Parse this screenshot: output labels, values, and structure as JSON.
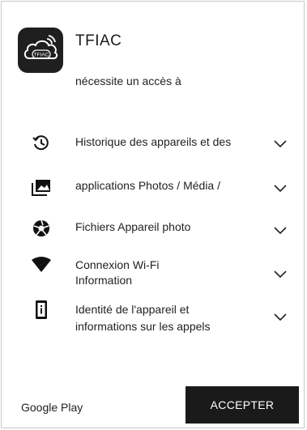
{
  "app": {
    "name": "TFIAC",
    "icon": "tfiac-cloud-logo-icon",
    "icon_text": "TFIAC"
  },
  "subtitle": "nécessite un accès à",
  "permissions": [
    {
      "icon": "history-icon",
      "label": "Historique des appareils et des"
    },
    {
      "icon": "photos-icon",
      "label": "applications Photos / Média /"
    },
    {
      "icon": "camera-aperture-icon",
      "label": "Fichiers Appareil photo"
    },
    {
      "icon": "wifi-icon",
      "label": "Connexion Wi-Fi\nInformation"
    },
    {
      "icon": "phone-info-icon",
      "label": "Identité de l'appareil et\ninformations sur les appels"
    }
  ],
  "footer": {
    "store_label": "Google Play",
    "accept_label": "ACCEPTER"
  },
  "colors": {
    "button_bg": "#1a1a1a",
    "icon_bg": "#1f1f1f",
    "text": "#222222"
  }
}
